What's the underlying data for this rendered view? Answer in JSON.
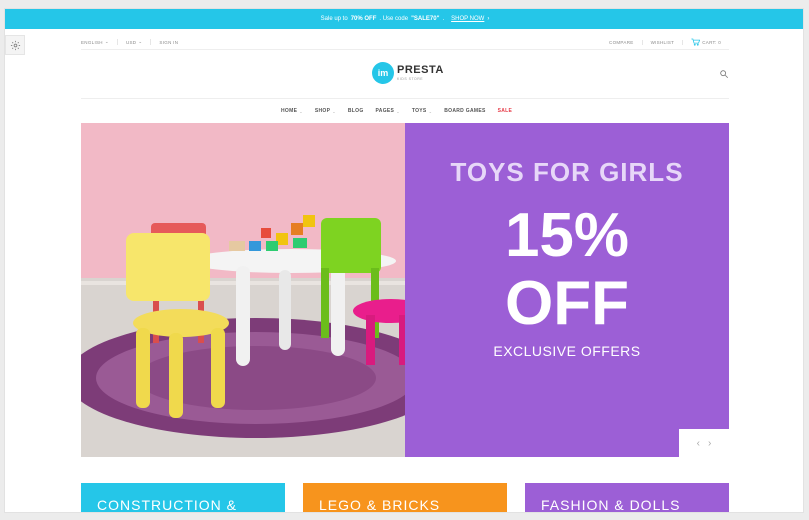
{
  "promo": {
    "text_a": "Sale up to",
    "percent": "70% OFF",
    "text_b": ". Use code",
    "code": "\"SALE70\"",
    "text_c": ".",
    "shop_now": "SHOP NOW"
  },
  "topbar": {
    "language": "ENGLISH",
    "currency": "USD",
    "sign_in": "SIGN IN",
    "compare": "COMPARE",
    "wishlist": "WISHLIST",
    "cart": "CART: 0"
  },
  "logo": {
    "badge": "im",
    "name": "PRESTA",
    "sub": "KIDS STORE"
  },
  "nav": {
    "items": [
      "HOME",
      "SHOP",
      "BLOG",
      "PAGES",
      "TOYS",
      "BOARD GAMES",
      "SALE"
    ]
  },
  "hero": {
    "title": "TOYS FOR GIRLS",
    "percent": "15%",
    "off": "OFF",
    "subtitle": "EXCLUSIVE OFFERS",
    "prev": "‹",
    "next": "›"
  },
  "categories": [
    {
      "label": "CONSTRUCTION &",
      "color": "#25c6e8"
    },
    {
      "label": "LEGO & BRICKS",
      "color": "#f7941d"
    },
    {
      "label": "FASHION & DOLLS",
      "color": "#9c5fd6"
    }
  ],
  "colors": {
    "accent": "#25c6e8",
    "purple": "#9c5fd6",
    "sale": "#e63946"
  }
}
